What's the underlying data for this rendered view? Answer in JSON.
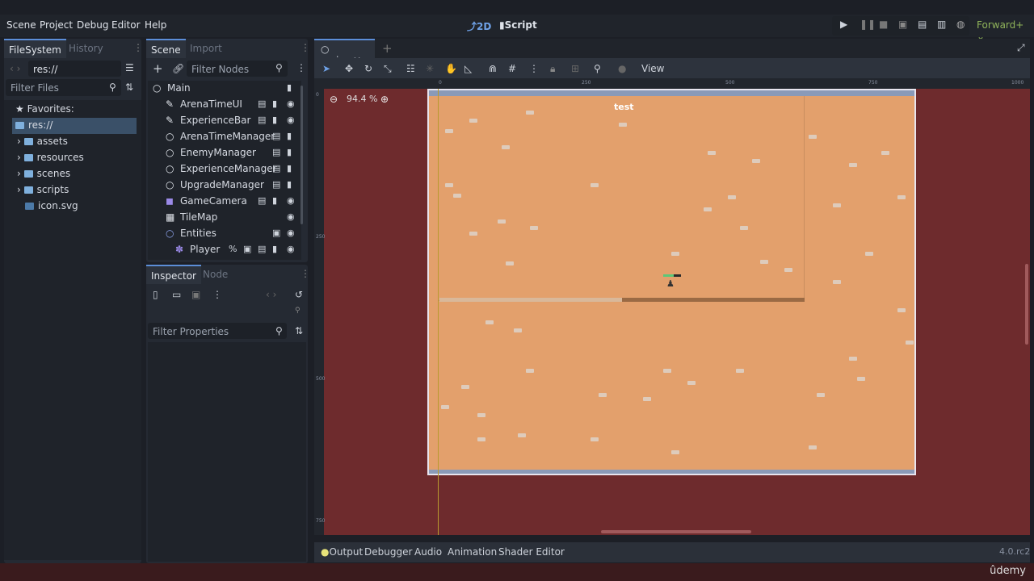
{
  "menu": [
    "Scene",
    "Project",
    "Debug",
    "Editor",
    "Help"
  ],
  "workspaces": {
    "two_d": "2D",
    "script": "Script"
  },
  "renderer": "Forward+",
  "filesystem": {
    "tabs": [
      "FileSystem",
      "History"
    ],
    "path": "res://",
    "filter_placeholder": "Filter Files",
    "favorites": "Favorites:",
    "root": "res://",
    "items": [
      "assets",
      "resources",
      "scenes",
      "scripts",
      "icon.svg"
    ]
  },
  "scene": {
    "tabs": [
      "Scene",
      "Import"
    ],
    "filter_placeholder": "Filter Nodes",
    "nodes": [
      "Main",
      "ArenaTimeUI",
      "ExperienceBar",
      "ArenaTimeManager",
      "EnemyManager",
      "ExperienceManager",
      "UpgradeManager",
      "GameCamera",
      "TileMap",
      "Entities",
      "Player"
    ],
    "unique_marker": "%"
  },
  "inspector": {
    "tabs": [
      "Inspector",
      "Node"
    ],
    "filter_placeholder": "Filter Properties"
  },
  "editor": {
    "tab": "main",
    "view_menu": "View",
    "zoom": "94.4 %",
    "ruler": [
      "0",
      "250",
      "500",
      "750",
      "1000"
    ],
    "vruler": [
      "0",
      "250",
      "500",
      "750"
    ],
    "label": "test",
    "experience_progress": 0.5
  },
  "bottom": {
    "tabs": [
      "Output",
      "Debugger",
      "Audio",
      "Animation",
      "Shader Editor"
    ],
    "version": "4.0.rc2"
  },
  "watermark": "ûdemy",
  "colors": {
    "accent": "#5c8ed8",
    "viewport": "#6e2b2d",
    "sand": "#e3a06c",
    "renderer": "#8fb35a"
  }
}
